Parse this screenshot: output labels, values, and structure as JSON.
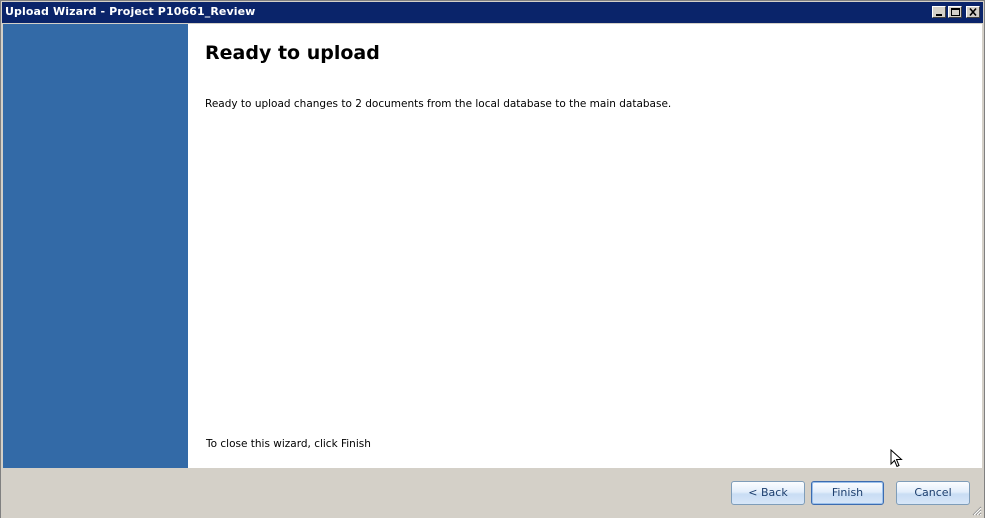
{
  "window": {
    "title": "Upload Wizard - Project P10661_Review"
  },
  "main": {
    "heading": "Ready to upload",
    "description": "Ready to upload changes to 2 documents from the local database to the main database.",
    "close_note": "To close this wizard, click Finish"
  },
  "buttons": {
    "back_label": "< Back",
    "finish_label": "Finish",
    "cancel_label": "Cancel"
  },
  "colors": {
    "titlebar": "#0a246a",
    "sidebar": "#336aa7",
    "dialog_background": "#d4d0c8"
  },
  "icons": {
    "minimize": "minimize-icon",
    "maximize": "maximize-icon",
    "close": "close-icon",
    "cursor": "mouse-cursor-icon",
    "resize": "resize-grip-icon"
  }
}
